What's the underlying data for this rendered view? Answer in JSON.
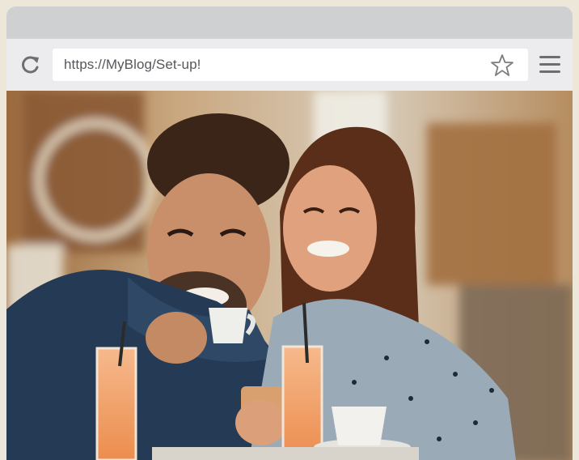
{
  "browser": {
    "url": "https://MyBlog/Set-up!",
    "icons": {
      "reload": "reload-icon",
      "bookmark": "star-icon",
      "menu": "hamburger-menu-icon"
    }
  },
  "content": {
    "image_semantic": "photo of two people laughing at a cafe table looking at a smartphone"
  },
  "colors": {
    "toolbar": "#ececee",
    "frame": "#d3d3d4",
    "icon": "#6d6e72"
  }
}
